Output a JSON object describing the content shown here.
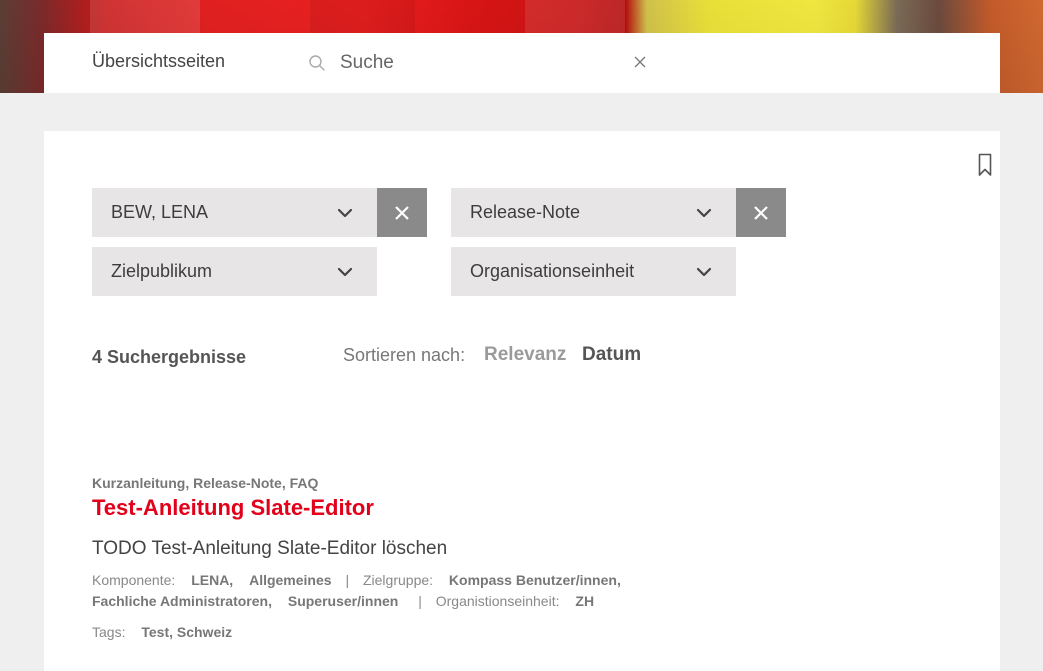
{
  "header": {
    "overview_label": "Übersichtsseiten",
    "search_placeholder": "Suche",
    "search_value": "",
    "icons": {
      "search": "search-icon",
      "clear": "close-icon"
    }
  },
  "filters": [
    {
      "label": "BEW, LENA",
      "has_clear": true
    },
    {
      "label": "Release-Note",
      "has_clear": true
    },
    {
      "label": "Zielpublikum",
      "has_clear": false
    },
    {
      "label": "Organisationseinheit",
      "has_clear": false
    }
  ],
  "results": {
    "count_label": "4 Suchergebnisse",
    "sort_label": "Sortieren nach:",
    "sort_options": [
      "Relevanz",
      "Datum"
    ],
    "sort_active": "Datum"
  },
  "result_item": {
    "types": "Kurzanleitung, Release-Note, FAQ",
    "title": "Test-Anleitung Slate-Editor",
    "description": "TODO Test-Anleitung Slate-Editor löschen",
    "component_label": "Komponente:",
    "component_values": [
      "LENA,",
      "Allgemeines"
    ],
    "target_label": "Zielgruppe:",
    "target_values": [
      "Kompass Benutzer/innen,",
      "Fachliche Administratoren,",
      "Superuser/innen"
    ],
    "org_label": "Organistionseinheit:",
    "org_value": "ZH",
    "tags_label": "Tags:",
    "tags_value": "Test, Schweiz",
    "separator": "|"
  },
  "colors": {
    "accent": "#e2001a",
    "filter_bg": "#e7e5e5",
    "clear_bg": "#8a8a8a",
    "page_bg": "#f0efef"
  }
}
